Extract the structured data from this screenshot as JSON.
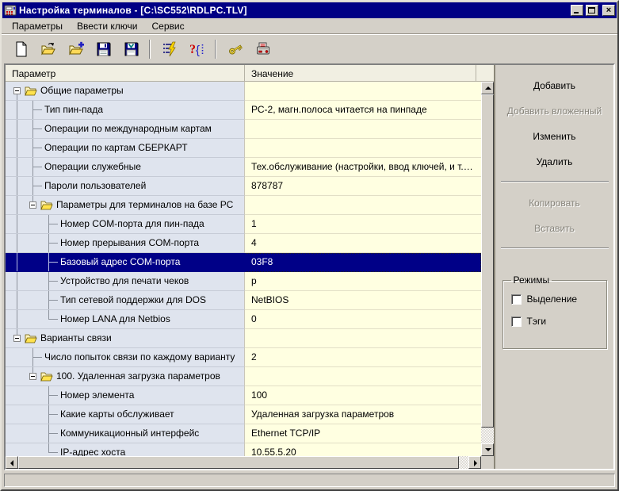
{
  "window": {
    "title": "Настройка терминалов - [C:\\SC552\\RDLPC.TLV]"
  },
  "menu": {
    "items": [
      "Параметры",
      "Ввести ключи",
      "Сервис"
    ]
  },
  "toolbar": {
    "groups": [
      [
        "new-file-icon",
        "open-file-icon",
        "open-file-add-icon",
        "save-icon",
        "save-keys-icon"
      ],
      [
        "verify-config-icon",
        "help-syntax-icon"
      ],
      [
        "enter-keys-icon",
        "print-terminal-icon"
      ]
    ]
  },
  "table": {
    "columns": [
      "Параметр",
      "Значение"
    ],
    "rows": [
      {
        "param": "Общие параметры",
        "value": "",
        "level": 0,
        "kind": "folder"
      },
      {
        "param": "Тип пин-пада",
        "value": "РС-2, магн.полоса читается на пинпаде",
        "level": 1,
        "kind": "leaf"
      },
      {
        "param": "Операции по международным картам",
        "value": "",
        "level": 1,
        "kind": "leaf"
      },
      {
        "param": "Операции по картам СБЕРКАРТ",
        "value": "",
        "level": 1,
        "kind": "leaf"
      },
      {
        "param": "Операции служебные",
        "value": "Тех.обслуживание (настройки, ввод ключей, и т.д.), Уд...",
        "level": 1,
        "kind": "leaf"
      },
      {
        "param": "Пароли пользователей",
        "value": "878787",
        "level": 1,
        "kind": "leaf"
      },
      {
        "param": "Параметры для терминалов на базе РС",
        "value": "",
        "level": 1,
        "kind": "folder"
      },
      {
        "param": "Номер COM-порта для пин-пада",
        "value": "1",
        "level": 2,
        "kind": "leaf"
      },
      {
        "param": "Номер прерывания COM-порта",
        "value": "4",
        "level": 2,
        "kind": "leaf"
      },
      {
        "param": "Базовый адрес COM-порта",
        "value": "03F8",
        "level": 2,
        "kind": "leaf",
        "selected": true
      },
      {
        "param": "Устройство для печати чеков",
        "value": "p",
        "level": 2,
        "kind": "leaf"
      },
      {
        "param": "Тип сетевой поддержки для DOS",
        "value": "NetBIOS",
        "level": 2,
        "kind": "leaf"
      },
      {
        "param": "Номер LANA для Netbios",
        "value": "0",
        "level": 2,
        "kind": "leaf"
      },
      {
        "param": "Варианты связи",
        "value": "",
        "level": 0,
        "kind": "folder"
      },
      {
        "param": "Число попыток связи по каждому варианту",
        "value": "2",
        "level": 1,
        "kind": "leaf"
      },
      {
        "param": "100. Удаленная загрузка параметров",
        "value": "",
        "level": 1,
        "kind": "folder"
      },
      {
        "param": "Номер элемента",
        "value": "100",
        "level": 2,
        "kind": "leaf"
      },
      {
        "param": "Какие карты обслуживает",
        "value": "Удаленная загрузка параметров",
        "level": 2,
        "kind": "leaf"
      },
      {
        "param": "Коммуникационный интерфейс",
        "value": "Ethernet TCP/IP",
        "level": 2,
        "kind": "leaf"
      },
      {
        "param": "IP-адрес хоста",
        "value": "10.55.5.20",
        "level": 2,
        "kind": "leaf"
      }
    ]
  },
  "right_panel": {
    "buttons": [
      {
        "label": "Добавить",
        "enabled": true
      },
      {
        "label": "Добавить вложенный",
        "enabled": false
      },
      {
        "label": "Изменить",
        "enabled": true
      },
      {
        "label": "Удалить",
        "enabled": true
      },
      {
        "separator": true
      },
      {
        "label": "Копировать",
        "enabled": false
      },
      {
        "label": "Вставить",
        "enabled": false
      },
      {
        "separator": true
      }
    ],
    "modes": {
      "title": "Режимы",
      "options": [
        {
          "label": "Выделение",
          "checked": false
        },
        {
          "label": "Тэги",
          "checked": false
        }
      ]
    }
  },
  "statusbar": {
    "text": ""
  },
  "colors": {
    "titlebar": "#000085",
    "chrome": "#d4d0c8",
    "param_cell": "#dfe4ee",
    "value_cell": "#ffffe1",
    "selection": "#000087",
    "selection_text": "#ffffff"
  }
}
